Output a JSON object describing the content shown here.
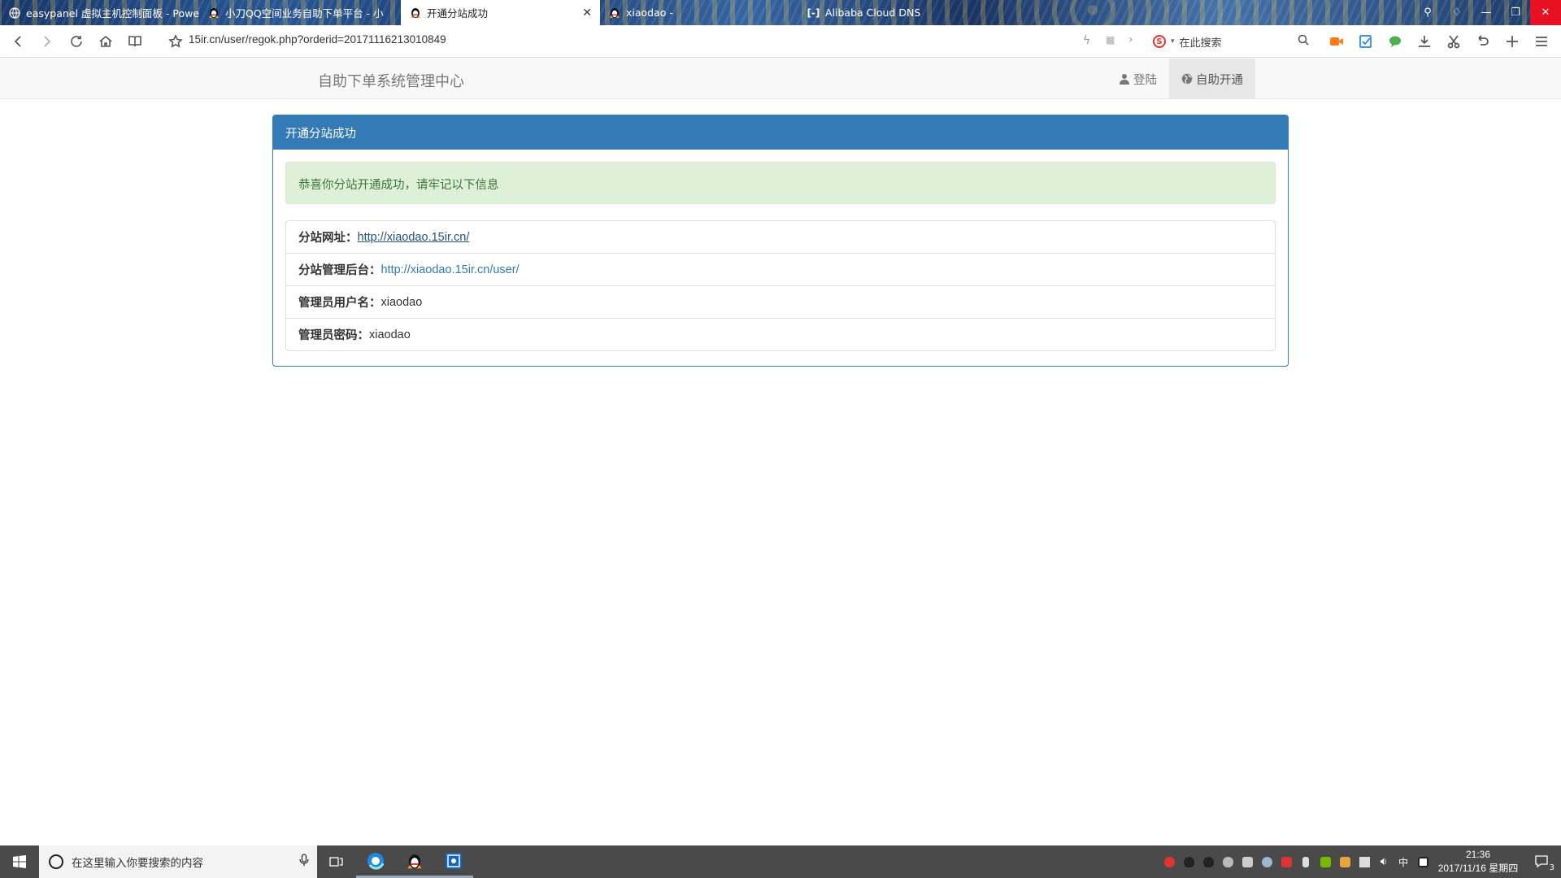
{
  "browser": {
    "tabs": [
      {
        "title": "easypanel 虚拟主机控制面板 - Powe",
        "icon": "globe-icon"
      },
      {
        "title": "小刀QQ空间业务自助下单平台 - 小",
        "icon": "qq-penguin-icon"
      },
      {
        "title": "开通分站成功",
        "icon": "qq-penguin-icon",
        "active": true
      },
      {
        "title": "xiaodao -",
        "icon": "qq-penguin-icon"
      },
      {
        "title": "Alibaba Cloud DNS",
        "icon": "alibaba-cloud-icon"
      }
    ],
    "address": "15ir.cn/user/regok.php?orderid=20171116213010849",
    "search_placeholder": "在此搜索"
  },
  "site": {
    "brand": "自助下单系统管理中心",
    "nav": {
      "login": "登陆",
      "open": "自助开通"
    }
  },
  "panel": {
    "title": "开通分站成功",
    "alert": "恭喜你分站开通成功，请牢记以下信息",
    "items": [
      {
        "label": "分站网址：",
        "value": "http://xiaodao.15ir.cn/"
      },
      {
        "label": "分站管理后台：",
        "value": "http://xiaodao.15ir.cn/user/"
      },
      {
        "label": "管理员用户名：",
        "value": "xiaodao"
      },
      {
        "label": "管理员密码：",
        "value": "xiaodao"
      }
    ]
  },
  "taskbar": {
    "search_placeholder": "在这里输入你要搜索的内容",
    "ime": "中",
    "time": "21:36",
    "date": "2017/11/16 星期四",
    "notification_count": "3"
  },
  "colors": {
    "primary": "#337ab7",
    "success_bg": "#dff0d8",
    "success_text": "#3c763d",
    "close_red": "#e81123"
  }
}
